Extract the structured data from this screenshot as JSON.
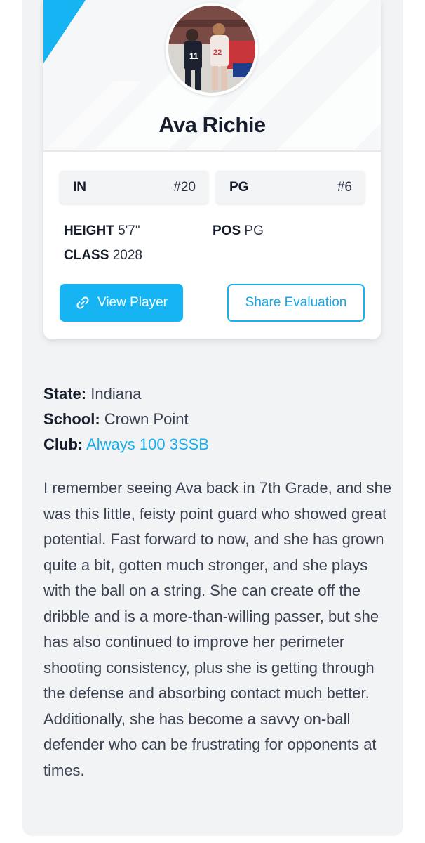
{
  "player": {
    "name": "Ava Richie",
    "avatar_alt": "player photo"
  },
  "tags": [
    {
      "key": "IN",
      "value": "#20"
    },
    {
      "key": "PG",
      "value": "#6"
    }
  ],
  "stats": {
    "height_label": "HEIGHT",
    "height_value": "5'7\"",
    "class_label": "CLASS",
    "class_value": "2028",
    "pos_label": "POS",
    "pos_value": "PG"
  },
  "buttons": {
    "view_player": "View Player",
    "share_evaluation": "Share Evaluation"
  },
  "details": {
    "state_label": "State:",
    "state_value": "Indiana",
    "school_label": "School:",
    "school_value": "Crown Point",
    "club_label": "Club:",
    "club_value": "Always 100 3SSB"
  },
  "evaluation_text": "I remember seeing Ava back in 7th Grade, and she was this little, feisty point guard who showed great potential. Fast forward to now, and she has grown quite a bit, gotten much stronger, and she plays with the ball on a string. She can create off the dribble and is a more-than-willing passer, but she has also continued to improve her perimeter shooting consistency, plus she is getting through the defense and absorbing contact much better. Additionally, she has become a savvy on-ball defender who can be frustrating for opponents at times.",
  "colors": {
    "accent": "#16b4f2",
    "link": "#19aee9",
    "panel_bg": "#f2f3f5"
  },
  "icons": {
    "view_player_icon": "link-icon"
  }
}
